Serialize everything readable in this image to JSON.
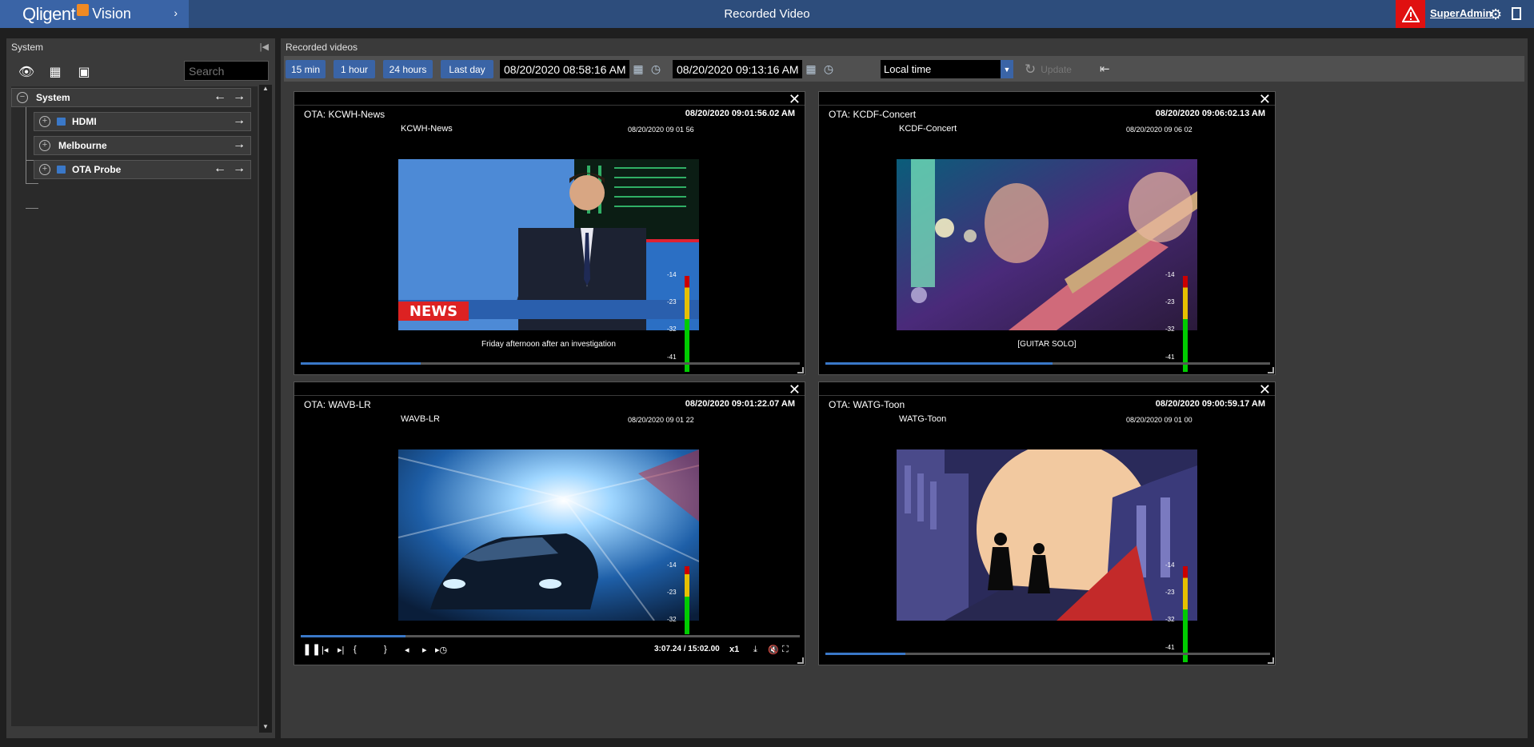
{
  "header": {
    "logo_text": "Qligent",
    "logo_product": "Vision",
    "title": "Recorded Video",
    "user": "SuperAdmin"
  },
  "left_panel": {
    "title": "System",
    "search_placeholder": "Search",
    "tree": [
      {
        "label": "System",
        "level": 0
      },
      {
        "label": "HDMI",
        "level": 1
      },
      {
        "label": "Melbourne",
        "level": 1
      },
      {
        "label": "OTA Probe",
        "level": 1
      }
    ]
  },
  "main": {
    "title": "Recorded videos",
    "ranges": [
      "15 min",
      "1 hour",
      "24 hours",
      "Last day"
    ],
    "start": "08/20/2020 08:58:16 AM",
    "end": "08/20/2020 09:13:16 AM",
    "timezone": "Local time",
    "update_label": "Update"
  },
  "tiles": [
    {
      "name": "OTA: KCWH-News",
      "timestamp": "08/20/2020 09:01:56.02 AM",
      "channel": "KCWH-News",
      "overlay_time": "08/20/2020 09 01 56",
      "caption": "Friday afternoon after an investigation",
      "progress": 0.24,
      "levels": [
        "-14",
        "-23",
        "-32",
        "-41"
      ]
    },
    {
      "name": "OTA: KCDF-Concert",
      "timestamp": "08/20/2020 09:06:02.13 AM",
      "channel": "KCDF-Concert",
      "overlay_time": "08/20/2020 09 06 02",
      "caption": "[GUITAR SOLO]",
      "progress": 0.51,
      "levels": [
        "-14",
        "-23",
        "-32",
        "-41"
      ]
    },
    {
      "name": "OTA: WAVB-LR",
      "timestamp": "08/20/2020 09:01:22.07 AM",
      "channel": "WAVB-LR",
      "overlay_time": "08/20/2020 09 01 22",
      "caption": "",
      "progress": 0.21,
      "levels": [
        "-14",
        "-23",
        "-32"
      ],
      "playback_time": "3:07.24 / 15:02.00",
      "speed": "x1"
    },
    {
      "name": "OTA: WATG-Toon",
      "timestamp": "08/20/2020 09:00:59.17 AM",
      "channel": "WATG-Toon",
      "overlay_time": "08/20/2020 09 01 00",
      "caption": "",
      "progress": 0.18,
      "levels": [
        "-14",
        "-23",
        "-32",
        "-41"
      ]
    }
  ]
}
